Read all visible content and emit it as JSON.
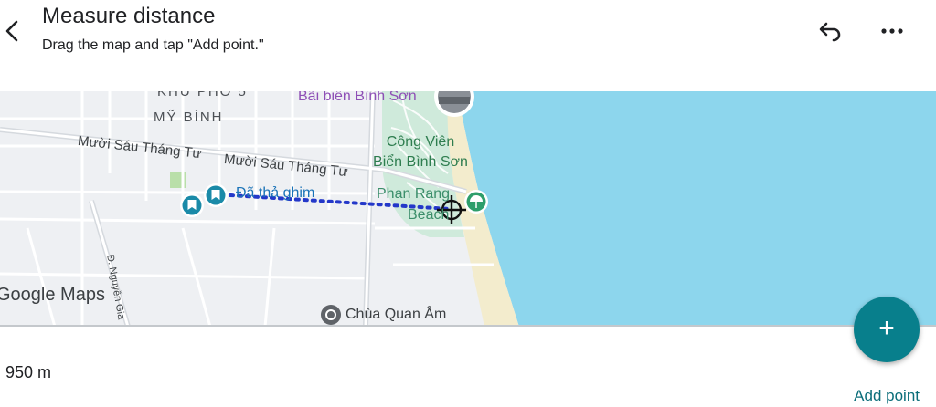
{
  "header": {
    "title": "Measure distance",
    "subtitle": "Drag the map and tap \"Add point.\""
  },
  "map": {
    "labels": {
      "khu_pho": "KHU PHỐ 5",
      "my_binh": "MỸ BÌNH",
      "street_1": "Mười Sáu Tháng Tư",
      "street_2": "Mười Sáu Tháng Tư",
      "beach_title": "Bãi biển Bình Sơn",
      "park_line1": "Công Viên",
      "park_line2": "Biển Bình Sơn",
      "beach_line1": "Phan Rang",
      "beach_line2": "Beach",
      "pinned": "Đã thả ghim",
      "side_street": "Đ. Nguyễn Gia",
      "temple": "Chùa Quan Âm"
    },
    "logo": "Google Maps"
  },
  "footer": {
    "distance": "950 m",
    "add_point": "Add point"
  },
  "colors": {
    "accent": "#087f8c",
    "water": "#8dd6ed",
    "route": "#2438c9"
  }
}
